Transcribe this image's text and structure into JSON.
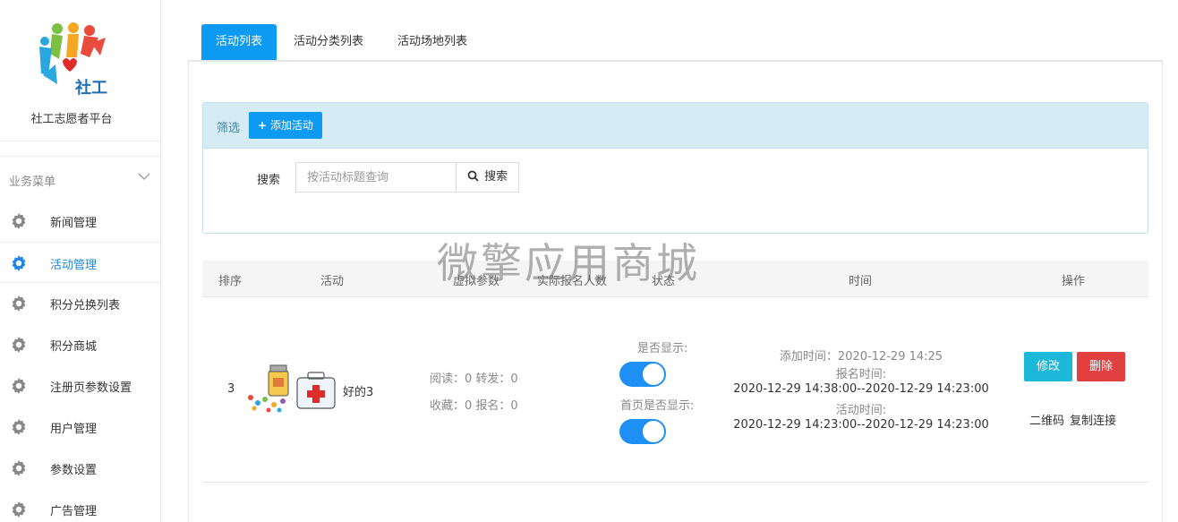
{
  "sidebar": {
    "platform_name": "社工志愿者平台",
    "logo_text": "社工",
    "menu_header": "业务菜单",
    "items": [
      {
        "label": "新闻管理",
        "icon": "gear-icon"
      },
      {
        "label": "活动管理",
        "icon": "gear-icon",
        "active": true
      },
      {
        "label": "积分兑换列表",
        "icon": "gear-icon"
      },
      {
        "label": "积分商城",
        "icon": "gear-icon"
      },
      {
        "label": "注册页参数设置",
        "icon": "gear-icon"
      },
      {
        "label": "用户管理",
        "icon": "gear-icon"
      },
      {
        "label": "参数设置",
        "icon": "gear-icon"
      },
      {
        "label": "广告管理",
        "icon": "gear-icon"
      }
    ]
  },
  "tabs": [
    {
      "label": "活动列表",
      "active": true
    },
    {
      "label": "活动分类列表"
    },
    {
      "label": "活动场地列表"
    }
  ],
  "filter": {
    "title": "筛选",
    "add_button": "添加活动",
    "search_label": "搜索",
    "search_placeholder": "按活动标题查询",
    "search_value": "",
    "search_button": "搜索"
  },
  "watermark": "微擎应用商城",
  "table": {
    "headers": [
      "排序",
      "活动",
      "虚拟参数",
      "实际报名人数",
      "状态",
      "时间",
      "操作"
    ],
    "rows": [
      {
        "sort": "3",
        "title": "好的3",
        "reads": "阅读：0 转发：0",
        "favs": "收藏：0 报名：0",
        "show_label": "是否显示:",
        "show_value": true,
        "home_show_label": "首页是否显示:",
        "home_show_value": true,
        "add_time": "添加时间：2020-12-29 14:25",
        "signup_label": "报名时间:",
        "signup_range": "2020-12-29 14:38:00--2020-12-29 14:23:00",
        "activity_label": "活动时间:",
        "activity_range": "2020-12-29 14:23:00--2020-12-29 14:23:00",
        "edit": "修改",
        "delete": "删除",
        "qrcode": "二维码",
        "copy_link": "复制连接"
      }
    ]
  },
  "colors": {
    "primary": "#0d9af2",
    "edit": "#1bb8d9",
    "delete": "#e14040",
    "filter_head": "#d6ecf5"
  }
}
